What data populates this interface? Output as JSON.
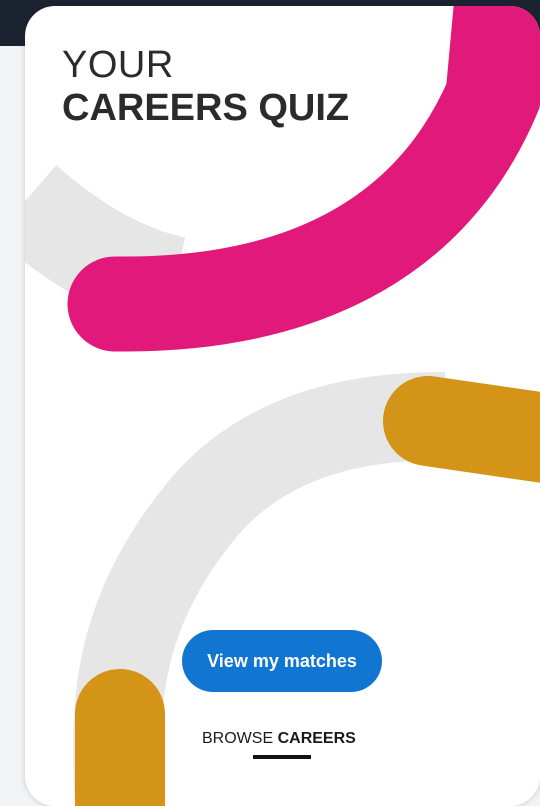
{
  "quiz": {
    "title_line1": "YOUR",
    "title_line2": "CAREERS QUIZ",
    "cta_label": "View my matches",
    "browse_prefix": "BROWSE",
    "browse_emphasis": "CAREERS"
  },
  "colors": {
    "header_bg": "#1c2330",
    "accent_magenta": "#e0197a",
    "accent_mustard": "#d39417",
    "track_gray": "#e6e6e6",
    "button_blue": "#1176d2",
    "title_text": "#2b2b2b"
  }
}
